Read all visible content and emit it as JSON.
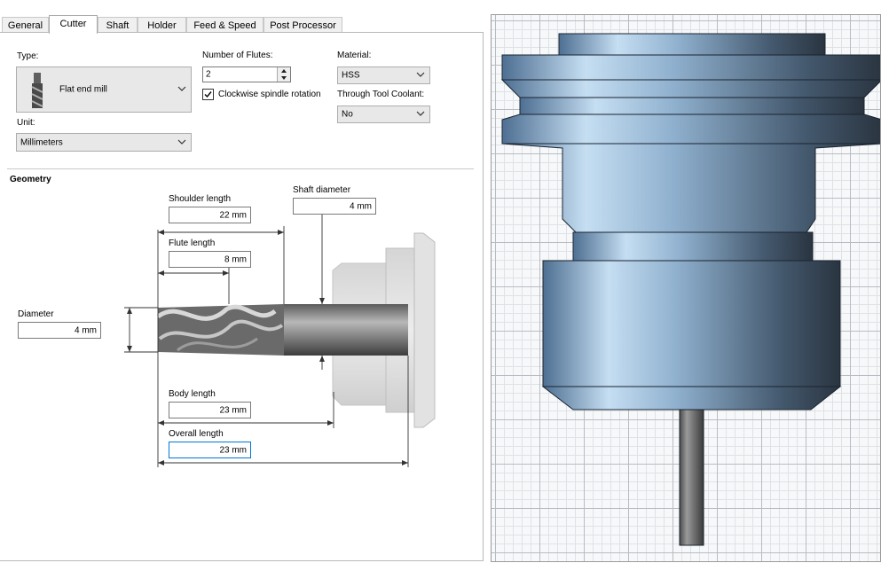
{
  "tabs": [
    {
      "label": "General"
    },
    {
      "label": "Cutter"
    },
    {
      "label": "Shaft"
    },
    {
      "label": "Holder"
    },
    {
      "label": "Feed & Speed"
    },
    {
      "label": "Post Processor"
    }
  ],
  "active_tab": "Cutter",
  "cutter": {
    "type_label": "Type:",
    "type_value": "Flat end mill",
    "unit_label": "Unit:",
    "unit_value": "Millimeters",
    "flutes_label": "Number of Flutes:",
    "flutes_value": "2",
    "clockwise_label": "Clockwise spindle rotation",
    "clockwise_checked": true,
    "material_label": "Material:",
    "material_value": "HSS",
    "coolant_label": "Through Tool Coolant:",
    "coolant_value": "No"
  },
  "geometry": {
    "title": "Geometry",
    "shoulder_length_label": "Shoulder length",
    "shoulder_length_value": "22 mm",
    "flute_length_label": "Flute length",
    "flute_length_value": "8 mm",
    "shaft_diameter_label": "Shaft diameter",
    "shaft_diameter_value": "4 mm",
    "diameter_label": "Diameter",
    "diameter_value": "4 mm",
    "body_length_label": "Body length",
    "body_length_value": "23 mm",
    "overall_length_label": "Overall length",
    "overall_length_value": "23 mm"
  },
  "icons": {
    "combo_arrow": "chevron-down-icon",
    "spin_up": "spin-up-icon",
    "spin_down": "spin-down-icon",
    "checkbox": "checkmark-icon",
    "tool_type": "flat-end-mill-icon"
  },
  "colors": {
    "focus_border": "#0078d7",
    "grid_major": "#b8bcc2",
    "grid_minor": "#dfe2e6",
    "holder_blue": "#7fa0c0"
  }
}
